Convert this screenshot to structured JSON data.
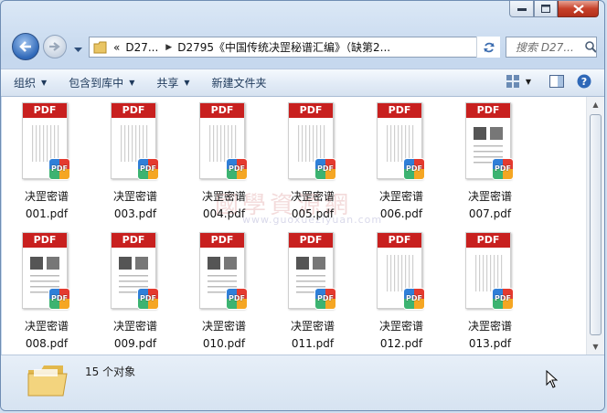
{
  "window": {
    "controls": {
      "minimize": "minimize",
      "maximize": "maximize",
      "close": "close"
    }
  },
  "nav": {
    "address": {
      "prefix": "«",
      "segments": [
        "D27...",
        "D2795《中国传统决罡秘谱汇编》（缺第2..."
      ]
    },
    "search_placeholder": "搜索 D27..."
  },
  "toolbar": {
    "organize": "组织",
    "include_library": "包含到库中",
    "share": "共享",
    "new_folder": "新建文件夹"
  },
  "files": [
    {
      "line1": "决罡密谱",
      "line2": "001.pdf"
    },
    {
      "line1": "决罡密谱",
      "line2": "003.pdf"
    },
    {
      "line1": "决罡密谱",
      "line2": "004.pdf"
    },
    {
      "line1": "决罡密谱",
      "line2": "005.pdf"
    },
    {
      "line1": "决罡密谱",
      "line2": "006.pdf"
    },
    {
      "line1": "决罡密谱",
      "line2": "007.pdf"
    },
    {
      "line1": "决罡密谱",
      "line2": "008.pdf"
    },
    {
      "line1": "决罡密谱",
      "line2": "009.pdf"
    },
    {
      "line1": "决罡密谱",
      "line2": "010.pdf"
    },
    {
      "line1": "决罡密谱",
      "line2": "011.pdf"
    },
    {
      "line1": "决罡密谱",
      "line2": "012.pdf"
    },
    {
      "line1": "决罡密谱",
      "line2": "013.pdf"
    }
  ],
  "pdf_label": "PDF",
  "watermark": {
    "cn": "國學資源網",
    "url": "www.guoxueziyuan.com"
  },
  "status": {
    "count_text": "15 个对象"
  },
  "colors": {
    "pdf_red": "#c8201f",
    "window_frame": "#c6d8ee",
    "accent_blue": "#2f68b8"
  }
}
